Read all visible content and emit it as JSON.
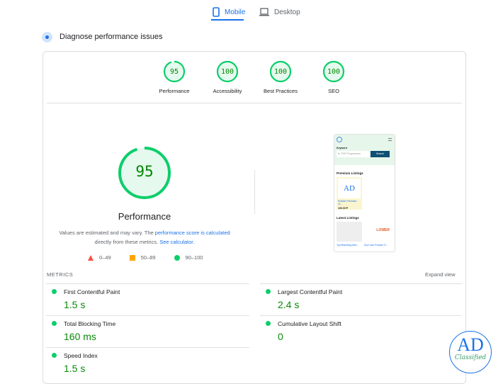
{
  "tabs": [
    {
      "label": "Mobile",
      "icon": "phone-icon",
      "active": true
    },
    {
      "label": "Desktop",
      "icon": "laptop-icon",
      "active": false
    }
  ],
  "section_title": "Diagnose performance issues",
  "categories": [
    {
      "label": "Performance",
      "score": "95"
    },
    {
      "label": "Accessibility",
      "score": "100"
    },
    {
      "label": "Best Practices",
      "score": "100"
    },
    {
      "label": "SEO",
      "score": "100"
    }
  ],
  "main_gauge": {
    "score": "95",
    "label": "Performance",
    "fraction": 0.95
  },
  "note": {
    "prefix": "Values are estimated and may vary. The ",
    "link1": "performance score is calculated",
    "middle": " directly from these metrics. ",
    "link2": "See calculator."
  },
  "legend": [
    {
      "range": "0–49",
      "color": "#ff4e42"
    },
    {
      "range": "50–89",
      "color": "#ffa400"
    },
    {
      "range": "90–100",
      "color": "#0cce6b"
    }
  ],
  "screenshot": {
    "keyword_label": "Keyword",
    "search_placeholder": "ie. PHP Programmer",
    "search_button": "Search",
    "premium_title": "Premium Listings",
    "premium_item": "Publish Premium Cl...",
    "premium_price": "100.00 ₱",
    "latest_title": "Latest Listings",
    "latest_items": [
      "Top Branding Adm...",
      "Dry Lube Powder G..."
    ]
  },
  "metrics_header": "METRICS",
  "expand_label": "Expand view",
  "metrics": [
    {
      "label": "First Contentful Paint",
      "value": "1.5 s"
    },
    {
      "label": "Largest Contentful Paint",
      "value": "2.4 s"
    },
    {
      "label": "Total Blocking Time",
      "value": "160 ms"
    },
    {
      "label": "Cumulative Layout Shift",
      "value": "0"
    },
    {
      "label": "Speed Index",
      "value": "1.5 s"
    }
  ],
  "watermark": {
    "title": "AD",
    "subtitle": "Classified"
  }
}
